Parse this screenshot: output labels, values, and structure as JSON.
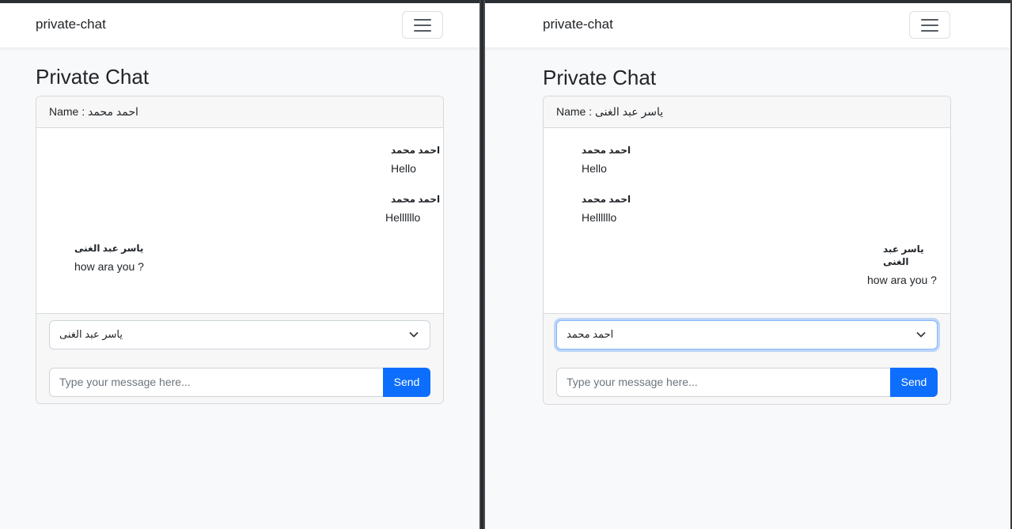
{
  "windows": [
    {
      "brand": "private-chat",
      "title": "Private Chat",
      "header": "Name : احمد محمد",
      "messages": [
        {
          "sender": "احمد محمد",
          "text": "Hello",
          "align": "end"
        },
        {
          "sender": "احمد محمد",
          "text": "Hellllllo",
          "align": "end"
        },
        {
          "sender": "ياسر عبد الغنى",
          "text": "how ara you ?",
          "align": "start"
        }
      ],
      "recipient_selected": "ياسر عبد الغنى",
      "message_placeholder": "Type your message here...",
      "send_label": "Send"
    },
    {
      "brand": "private-chat",
      "title": "Private Chat",
      "header": "Name : ياسر عبد الغنى",
      "messages": [
        {
          "sender": "احمد محمد",
          "text": "Hello",
          "align": "start"
        },
        {
          "sender": "احمد محمد",
          "text": "Hellllllo",
          "align": "start"
        },
        {
          "sender": "ياسر عبد الغنى",
          "text": "how ara you ?",
          "align": "end"
        }
      ],
      "recipient_selected": "احمد محمد",
      "message_placeholder": "Type your message here...",
      "send_label": "Send"
    }
  ],
  "colors": {
    "primary": "#0d6efd",
    "background": "#f8f9fa",
    "focus_ring": "#86b7fe"
  },
  "icons": {
    "menu": "hamburger-icon",
    "dropdown": "chevron-down-icon"
  }
}
